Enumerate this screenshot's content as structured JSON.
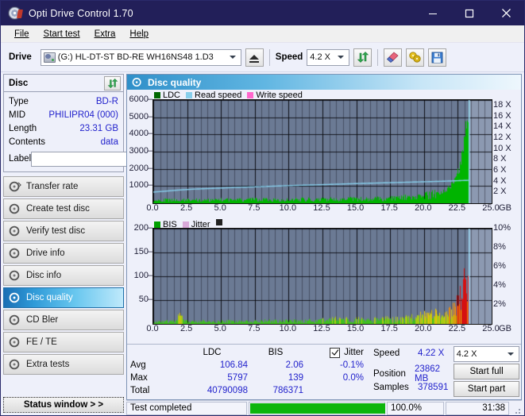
{
  "window": {
    "title": "Opti Drive Control 1.70",
    "icon": "disc-icon",
    "minimize": "minimize",
    "maximize": "maximize",
    "close": "close"
  },
  "menu": [
    "File",
    "Start test",
    "Extra",
    "Help"
  ],
  "toolbar": {
    "drive_label": "Drive",
    "drive_value": "(G:)  HL-DT-ST BD-RE  WH16NS48 1.D3",
    "eject": "eject",
    "speed_label": "Speed",
    "speed_value": "4.2 X",
    "refresh_icon": "refresh-icon",
    "erase_icon": "eraser-icon",
    "tools_icon": "tools-icon",
    "save_icon": "save-icon"
  },
  "disc": {
    "title": "Disc",
    "refresh_icon": "refresh-icon",
    "rows": [
      {
        "key": "Type",
        "value": "BD-R"
      },
      {
        "key": "MID",
        "value": "PHILIPR04 (000)"
      },
      {
        "key": "Length",
        "value": "23.31 GB"
      },
      {
        "key": "Contents",
        "value": "data"
      }
    ],
    "label_key": "Label",
    "label_value": "",
    "label_placeholder": "",
    "label_button_icon": "disc-icon"
  },
  "nav": {
    "items": [
      {
        "label": "Transfer rate",
        "selected": false
      },
      {
        "label": "Create test disc",
        "selected": false
      },
      {
        "label": "Verify test disc",
        "selected": false
      },
      {
        "label": "Drive info",
        "selected": false
      },
      {
        "label": "Disc info",
        "selected": false
      },
      {
        "label": "Disc quality",
        "selected": true
      },
      {
        "label": "CD Bler",
        "selected": false
      },
      {
        "label": "FE / TE",
        "selected": false
      },
      {
        "label": "Extra tests",
        "selected": false
      }
    ],
    "status_window": "Status window > >"
  },
  "panel": {
    "title": "Disc quality",
    "icon": "disc-quality-icon"
  },
  "stats": {
    "col_ldc": "LDC",
    "col_bis": "BIS",
    "col_jitter": "Jitter",
    "jitter_checked": true,
    "rows": [
      {
        "label": "Avg",
        "ldc": "106.84",
        "bis": "2.06",
        "jitter": "-0.1%"
      },
      {
        "label": "Max",
        "ldc": "5797",
        "bis": "139",
        "jitter": "0.0%"
      },
      {
        "label": "Total",
        "ldc": "40790098",
        "bis": "786371",
        "jitter": ""
      }
    ],
    "speed_label": "Speed",
    "speed_value": "4.22 X",
    "position_label": "Position",
    "position_value": "23862 MB",
    "samples_label": "Samples",
    "samples_value": "378591",
    "speed_select": "4.2 X",
    "start_full": "Start full",
    "start_part": "Start part"
  },
  "statusbar": {
    "message": "Test completed",
    "percent_label": "100.0%",
    "percent_value": 100,
    "time": "31:38"
  },
  "colors": {
    "ldc": "#00b400",
    "read_speed": "#87ceeb",
    "write_speed": "#ff66cc",
    "bis": "#00b400",
    "jitter": "#d9a9d9",
    "plot_bg": "#6b7a94",
    "accent": "#2222cc"
  },
  "chart_data": [
    {
      "type": "area",
      "name": "disc-quality-ldc-chart",
      "title": "",
      "xlabel": "GB",
      "ylabel": "",
      "xlim": [
        0,
        25
      ],
      "ylim": [
        0,
        6000
      ],
      "y2lim": [
        0,
        19
      ],
      "y2label": "X",
      "grid": true,
      "legend": [
        {
          "label": "LDC",
          "color": "#006600"
        },
        {
          "label": "Read speed",
          "color": "#87ceeb"
        },
        {
          "label": "Write speed",
          "color": "#ff66cc"
        }
      ],
      "xticks": [
        "0.0",
        "2.5",
        "5.0",
        "7.5",
        "10.0",
        "12.5",
        "15.0",
        "17.5",
        "20.0",
        "22.5",
        "25.0"
      ],
      "yticks": [
        1000,
        2000,
        3000,
        4000,
        5000,
        6000
      ],
      "y2ticks": [
        "2 X",
        "4 X",
        "6 X",
        "8 X",
        "10 X",
        "12 X",
        "14 X",
        "16 X",
        "18 X"
      ],
      "data_end_gb": 23.31,
      "series": [
        {
          "name": "LDC",
          "color": "#00b400",
          "x": [
            0.0,
            0.5,
            1.0,
            1.6,
            2.2,
            3.0,
            3.8,
            4.5,
            5.2,
            6.0,
            6.8,
            7.5,
            8.2,
            9.0,
            9.8,
            10.5,
            11.2,
            12.0,
            12.8,
            13.5,
            14.2,
            15.0,
            15.8,
            16.5,
            17.2,
            18.0,
            18.6,
            19.2,
            19.8,
            20.3,
            20.8,
            21.2,
            21.6,
            22.0,
            22.3,
            22.6,
            22.8,
            23.0,
            23.15,
            23.25,
            23.31
          ],
          "values": [
            150,
            160,
            170,
            180,
            170,
            175,
            165,
            180,
            175,
            170,
            185,
            190,
            180,
            195,
            185,
            200,
            195,
            205,
            200,
            215,
            210,
            225,
            220,
            240,
            250,
            270,
            300,
            330,
            380,
            430,
            520,
            640,
            800,
            1100,
            1500,
            2100,
            2900,
            4000,
            5100,
            5800,
            5900
          ]
        },
        {
          "name": "Read speed",
          "color": "#87ceeb",
          "x": [
            0.0,
            1.0,
            2.0,
            3.0,
            4.5,
            6.0,
            7.5,
            9.0,
            10.5,
            12.0,
            13.5,
            15.0,
            16.5,
            18.0,
            19.5,
            21.0,
            22.0,
            22.8,
            23.31
          ],
          "values": [
            2.05,
            2.25,
            2.45,
            2.6,
            2.75,
            2.9,
            3.02,
            3.15,
            3.28,
            3.38,
            3.5,
            3.62,
            3.72,
            3.82,
            3.92,
            4.02,
            4.1,
            4.18,
            4.22
          ]
        }
      ]
    },
    {
      "type": "area",
      "name": "disc-quality-bis-chart",
      "title": "",
      "xlabel": "GB",
      "ylabel": "",
      "xlim": [
        0,
        25
      ],
      "ylim": [
        0,
        200
      ],
      "y2lim": [
        0,
        10
      ],
      "y2label": "%",
      "grid": true,
      "legend": [
        {
          "label": "BIS",
          "color": "#00a000"
        },
        {
          "label": "Jitter",
          "color": "#d9a9d9"
        }
      ],
      "xticks": [
        "0.0",
        "2.5",
        "5.0",
        "7.5",
        "10.0",
        "12.5",
        "15.0",
        "17.5",
        "20.0",
        "22.5",
        "25.0"
      ],
      "yticks": [
        50,
        100,
        150,
        200
      ],
      "y2ticks": [
        "2%",
        "4%",
        "6%",
        "8%",
        "10%"
      ],
      "data_end_gb": 23.31,
      "series": [
        {
          "name": "BIS",
          "color": "gradient-green-yellow-orange-red",
          "x": [
            0.0,
            0.8,
            1.6,
            1.8,
            2.5,
            3.5,
            4.5,
            5.5,
            6.5,
            7.5,
            8.5,
            9.5,
            10.5,
            11.5,
            12.5,
            13.2,
            14.0,
            15.0,
            16.0,
            17.0,
            18.0,
            19.0,
            19.6,
            20.0,
            20.5,
            21.0,
            21.4,
            21.8,
            22.1,
            22.4,
            22.6,
            22.8,
            23.0,
            23.1,
            23.2,
            23.31
          ],
          "values": [
            3,
            4,
            5,
            16,
            4,
            5,
            4,
            5,
            4,
            5,
            6,
            5,
            6,
            6,
            7,
            9,
            8,
            9,
            8,
            9,
            10,
            12,
            14,
            16,
            18,
            20,
            22,
            26,
            33,
            45,
            62,
            80,
            100,
            92,
            116,
            60
          ]
        }
      ]
    }
  ]
}
